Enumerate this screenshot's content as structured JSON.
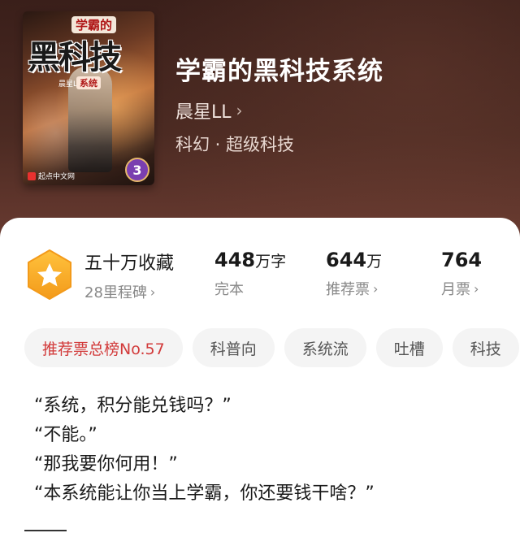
{
  "book": {
    "title": "学霸的黑科技系统",
    "author": "晨星LL",
    "genre": "科幻 · 超级科技",
    "cover": {
      "tag_top": "学霸的",
      "big_title": "黑科技",
      "small_tag": "系统",
      "author_mini": "晨星LL著",
      "publisher": "起点中文网",
      "level": "3"
    }
  },
  "stats": {
    "favorites": {
      "main": "五十万收藏",
      "sub": "28里程碑"
    },
    "words": {
      "value": "448",
      "unit": "万字",
      "sub": "完本"
    },
    "recommend": {
      "value": "644",
      "unit": "万",
      "sub": "推荐票"
    },
    "monthly": {
      "value": "764",
      "sub": "月票"
    }
  },
  "tags": [
    "推荐票总榜No.57",
    "科普向",
    "系统流",
    "吐槽",
    "科技"
  ],
  "quotes": [
    "“系统，积分能兑钱吗？”",
    "“不能。”",
    "“那我要你何用！”",
    "“本系统能让你当上学霸，你还要钱干啥？”"
  ],
  "icons": {
    "chevron": "›",
    "badge": "star-hexagon-icon"
  },
  "colors": {
    "header_top": "#3a1f1a",
    "header_bottom": "#6a3b31",
    "badge": "#f5a623",
    "hot_tag": "#d23a3a"
  }
}
